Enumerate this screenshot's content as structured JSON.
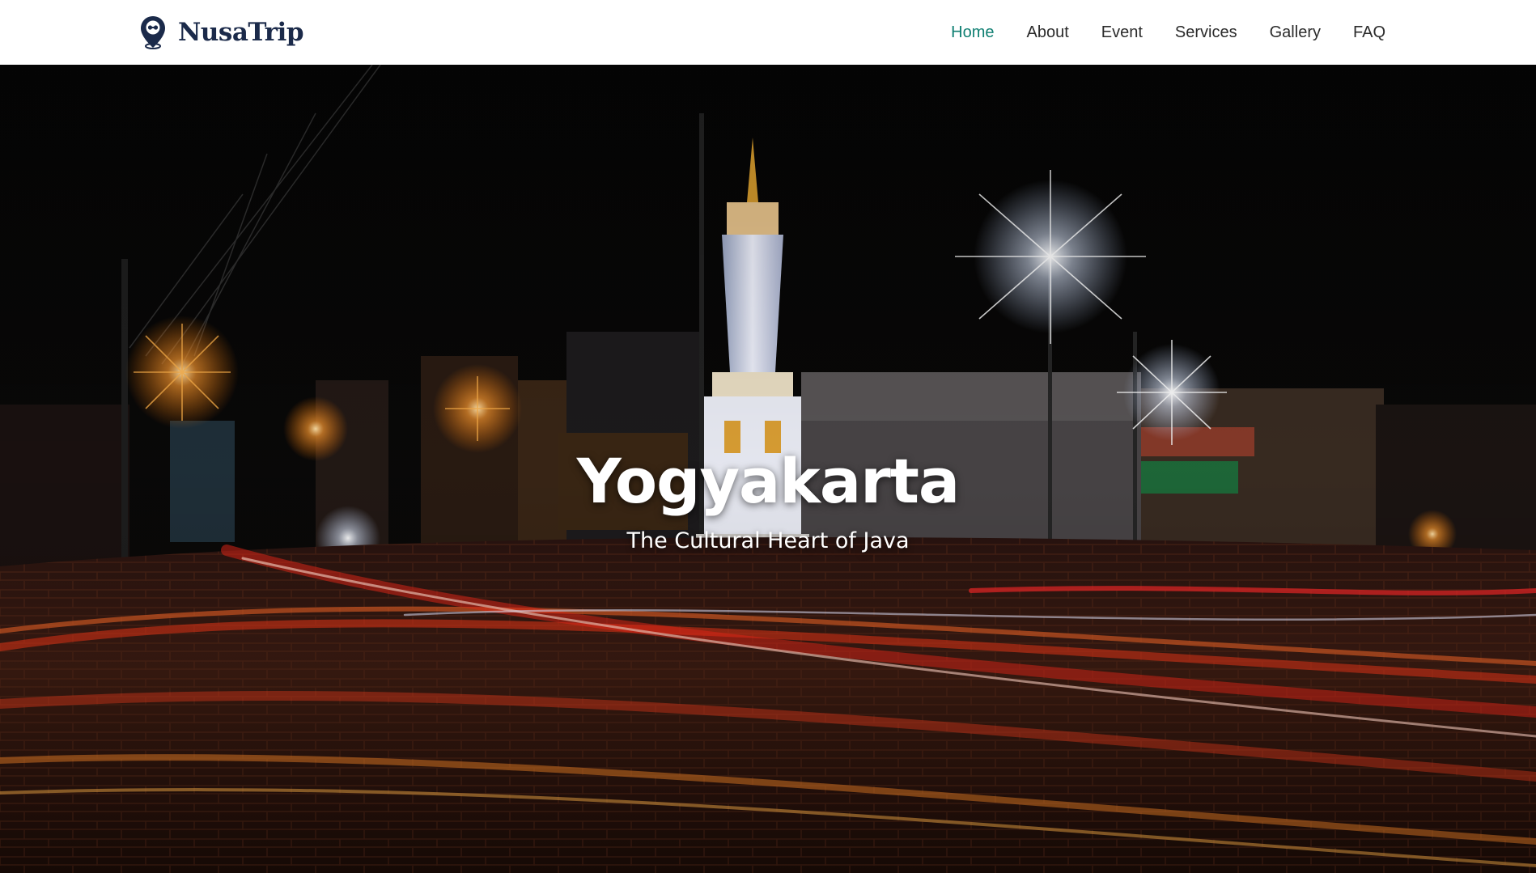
{
  "brand": {
    "name": "NusaTrip",
    "icon": "map-pin-icon",
    "color": "#1b2a4a"
  },
  "nav": {
    "items": [
      {
        "label": "Home",
        "active": true
      },
      {
        "label": "About",
        "active": false
      },
      {
        "label": "Event",
        "active": false
      },
      {
        "label": "Services",
        "active": false
      },
      {
        "label": "Gallery",
        "active": false
      },
      {
        "label": "FAQ",
        "active": false
      }
    ],
    "active_color": "#0f7f72"
  },
  "hero": {
    "title": "Yogyakarta",
    "subtitle": "The Cultural Heart of Java",
    "background_image": "night-street-tugu-monument-light-trails"
  }
}
